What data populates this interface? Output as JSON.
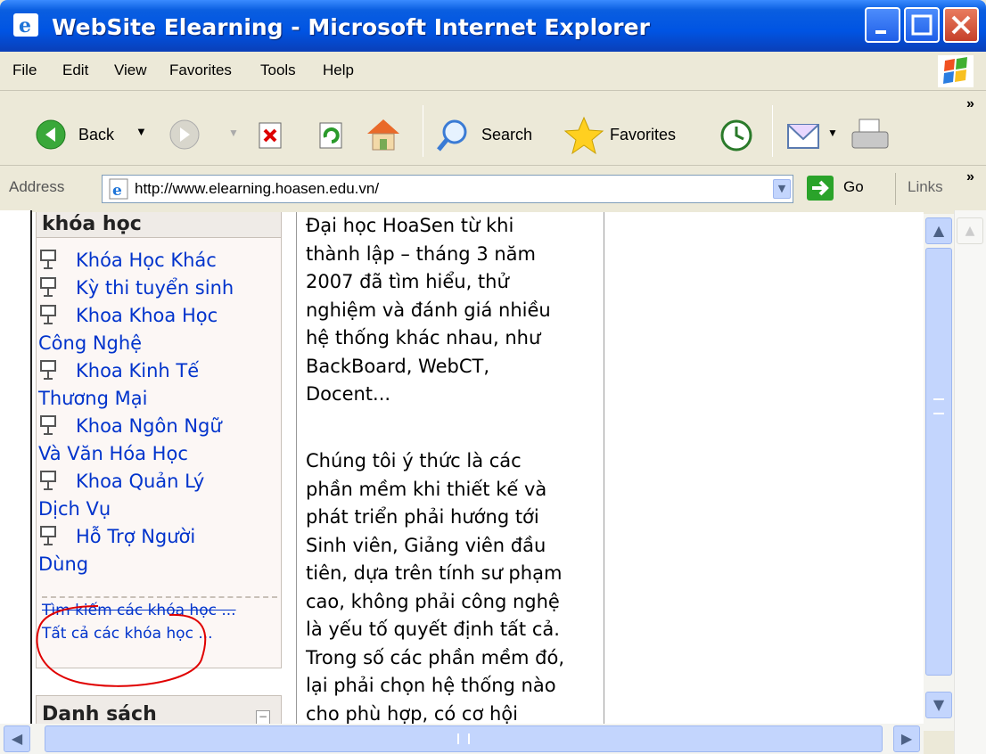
{
  "window": {
    "title": "WebSite Elearning - Microsoft Internet Explorer"
  },
  "menu": [
    "File",
    "Edit",
    "View",
    "Favorites",
    "Tools",
    "Help"
  ],
  "toolbar": {
    "back_label": "Back",
    "search_label": "Search",
    "favorites_label": "Favorites"
  },
  "address": {
    "label": "Address",
    "url": "http://www.elearning.hoasen.edu.vn/",
    "go_label": "Go",
    "links_label": "Links"
  },
  "sidebar": {
    "block_title": "khóa học",
    "courses": [
      {
        "lines": [
          "Khóa Học Khác"
        ]
      },
      {
        "lines": [
          "Kỳ thi tuyển sinh"
        ]
      },
      {
        "lines": [
          "Khoa Khoa Học",
          "Công Nghệ"
        ]
      },
      {
        "lines": [
          "Khoa Kinh Tế",
          "Thương Mại"
        ]
      },
      {
        "lines": [
          "Khoa Ngôn Ngữ",
          "Và Văn Hóa Học"
        ]
      },
      {
        "lines": [
          "Khoa Quản Lý",
          "Dịch Vụ"
        ]
      },
      {
        "lines": [
          "Hỗ Trợ Người",
          "Dùng"
        ]
      }
    ],
    "search_courses": "Tìm kiếm các khóa học ...",
    "all_courses": "Tất cả các khóa học ...",
    "block2_title": "Danh sách"
  },
  "main": {
    "para1": [
      "Đại học HoaSen từ khi",
      "thành lập – tháng 3 năm",
      "2007 đã tìm hiểu, thử",
      "nghiệm và đánh giá nhiều",
      "hệ thống khác nhau, như",
      "BackBoard, WebCT,",
      "Docent..."
    ],
    "para2": [
      "Chúng tôi ý thức là các",
      "phần mềm khi thiết kế và",
      "phát triển phải hướng tới",
      "Sinh viên, Giảng viên đầu",
      "tiên, dựa trên tính sư phạm",
      "cao, không phải công nghệ",
      "là yếu tố quyết định tất cả.",
      "Trong số các phần mềm đó,",
      "lại phải chọn hệ thống nào",
      "cho phù hợp, có cơ hội"
    ]
  },
  "colors": {
    "titlebar": "#0054e3",
    "link": "#0033cc",
    "annotation": "#e00000"
  },
  "icons": [
    "ie-icon",
    "back-icon",
    "forward-icon",
    "stop-icon",
    "refresh-icon",
    "home-icon",
    "search-icon",
    "favorites-star-icon",
    "history-icon",
    "mail-icon",
    "print-icon",
    "go-arrow-icon",
    "course-icon"
  ]
}
